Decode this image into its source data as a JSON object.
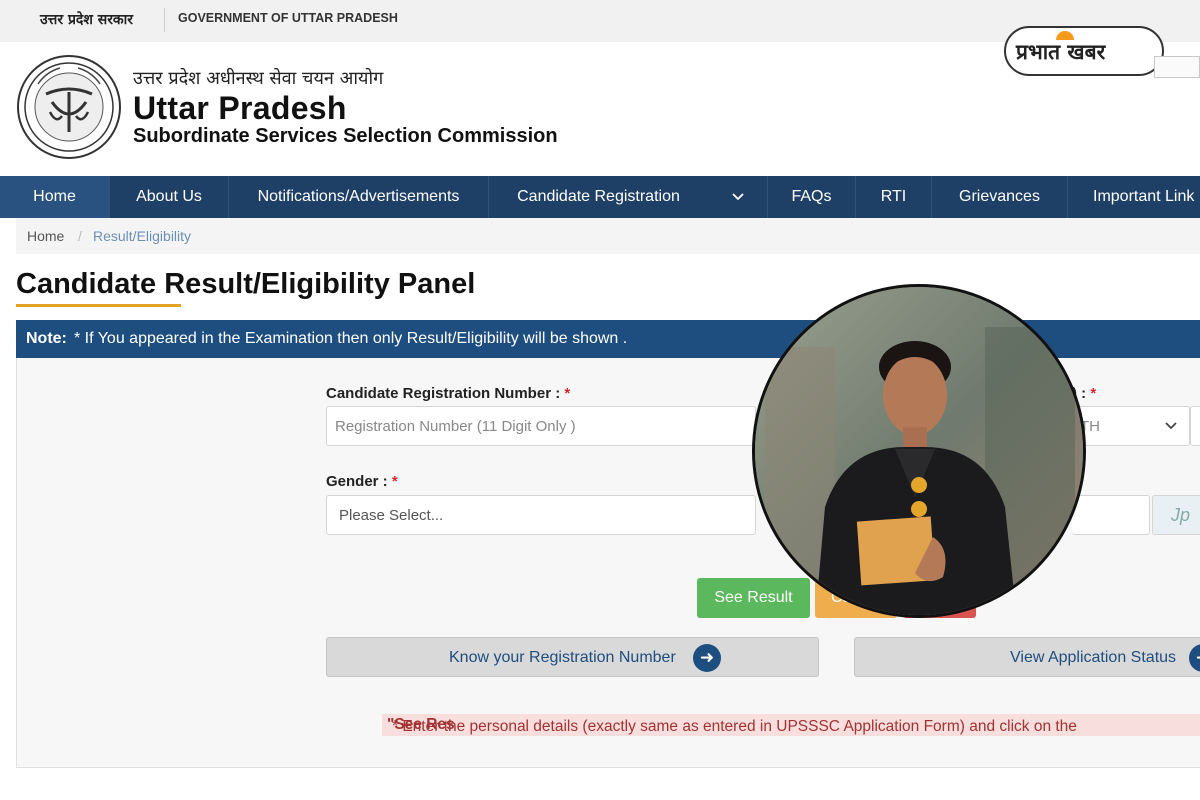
{
  "topbar": {
    "hindi_label": "उत्तर प्रदेश सरकार",
    "english_label": "GOVERNMENT OF UTTAR PRADESH"
  },
  "header": {
    "hindi_name": "उत्तर प्रदेश अधीनस्थ सेवा चयन आयोग",
    "title": "Uttar Pradesh",
    "subtitle": "Subordinate Services Selection Commission",
    "brand_logo_text": "प्रभात खबर"
  },
  "nav": {
    "items": [
      {
        "label": "Home",
        "active": true
      },
      {
        "label": "About Us"
      },
      {
        "label": "Notifications/Advertisements"
      },
      {
        "label": "Candidate Registration"
      },
      {
        "label": "FAQs"
      },
      {
        "label": "RTI"
      },
      {
        "label": "Grievances"
      },
      {
        "label": "Important Link"
      }
    ],
    "dropdown_icon": "chevron-down-icon"
  },
  "breadcrumb": {
    "home": "Home",
    "separator": "/",
    "current": "Result/Eligibility"
  },
  "page": {
    "title": "Candidate Result/Eligibility Panel"
  },
  "note": {
    "label": "Note:",
    "text": "* If You appeared in the Examination then only Result/Eligibility will be shown ."
  },
  "form": {
    "registration_label": "Candidate Registration Number :",
    "registration_placeholder": "Registration Number (11 Digit Only )",
    "dob_label_fragment": ") :",
    "dob_select_fragment": "TH",
    "gender_label": "Gender :",
    "gender_placeholder": "Please Select...",
    "required_mark": "*",
    "captcha_fragment": "Jp"
  },
  "buttons": {
    "see_result": "See Result",
    "orange_fragment": "Ca",
    "know_registration": "Know your Registration Number",
    "view_status": "View Application Status"
  },
  "disclaimer": {
    "text": "* Enter the personal details (exactly same as entered in UPSSSC Application Form) and click on the ",
    "highlight": "\"See Res"
  },
  "colors": {
    "nav_bg": "#1e3f66",
    "note_bg": "#1e4d80",
    "accent_orange": "#e4a224",
    "success": "#5cb85c",
    "warning": "#f0ad4e",
    "danger": "#d9534f",
    "required": "#d9262c"
  }
}
